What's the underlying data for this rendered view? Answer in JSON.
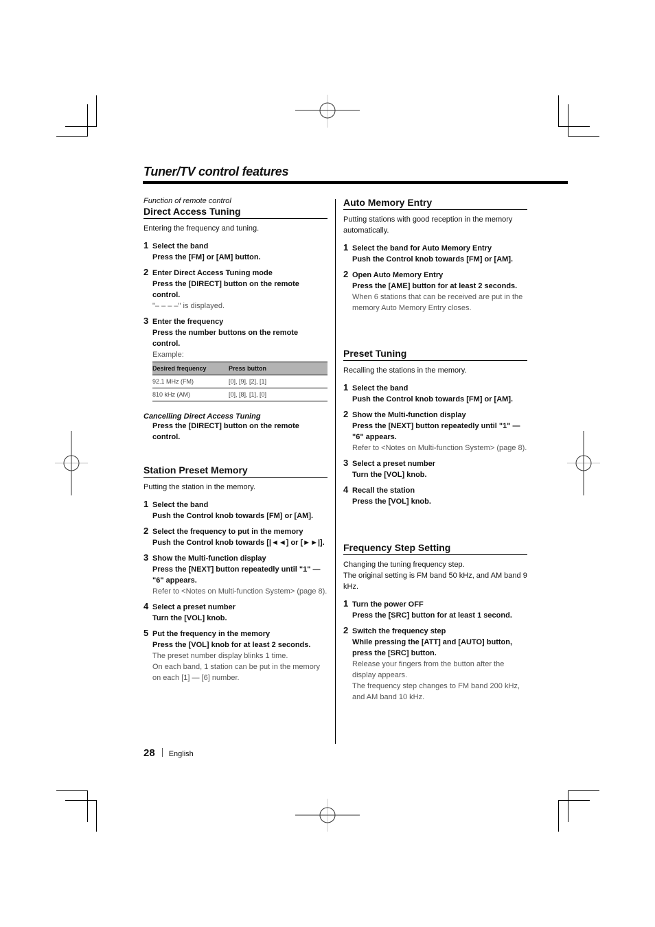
{
  "page": {
    "title": "Tuner/TV control features",
    "page_number": "28",
    "language": "English"
  },
  "left_column": {
    "direct_access": {
      "pre_heading": "Function of remote control",
      "heading": "Direct Access Tuning",
      "intro": "Entering the frequency and tuning.",
      "steps": [
        {
          "num": "1",
          "title": "Select the band",
          "action": "Press the [FM] or [AM] button.",
          "note": ""
        },
        {
          "num": "2",
          "title": "Enter Direct Access Tuning mode",
          "action": "Press the [DIRECT] button on the remote control.",
          "note": "\"– – – –\" is displayed."
        },
        {
          "num": "3",
          "title": "Enter the frequency",
          "action": "Press the number buttons on the remote control.",
          "note": "Example:"
        }
      ],
      "table": {
        "headers": [
          "Desired frequency",
          "Press button"
        ],
        "rows": [
          [
            "92.1 MHz (FM)",
            "[0], [9], [2], [1]"
          ],
          [
            "810 kHz (AM)",
            "[0], [8], [1], [0]"
          ]
        ]
      },
      "cancel": {
        "heading": "Cancelling Direct Access Tuning",
        "action": "Press the [DIRECT] button on the remote control."
      }
    },
    "station_preset": {
      "heading": "Station Preset Memory",
      "intro": "Putting the station in the memory.",
      "steps": [
        {
          "num": "1",
          "title": "Select the band",
          "action": "Push the Control knob towards [FM] or [AM].",
          "note": ""
        },
        {
          "num": "2",
          "title": "Select the frequency to put in the memory",
          "action": "Push the Control knob towards [|◄◄] or [►►|].",
          "note": ""
        },
        {
          "num": "3",
          "title": "Show the Multi-function display",
          "action": "Press the [NEXT] button repeatedly until \"1\" — \"6\" appears.",
          "note": "Refer to <Notes on Multi-function System> (page 8)."
        },
        {
          "num": "4",
          "title": "Select a preset number",
          "action": "Turn the [VOL] knob.",
          "note": ""
        },
        {
          "num": "5",
          "title": "Put the frequency in the memory",
          "action": "Press the [VOL] knob for at least 2 seconds.",
          "note": "The preset number display blinks 1 time.\nOn each band, 1 station can be put in the memory on each [1] — [6] number."
        }
      ]
    }
  },
  "right_column": {
    "auto_memory": {
      "heading": "Auto Memory Entry",
      "intro": "Putting stations with good reception in the memory automatically.",
      "steps": [
        {
          "num": "1",
          "title": "Select the band for Auto Memory Entry",
          "action": "Push the Control knob towards [FM] or [AM].",
          "note": ""
        },
        {
          "num": "2",
          "title": "Open Auto Memory Entry",
          "action": "Press the [AME] button for at least 2 seconds.",
          "note": "When 6 stations that can be received are put in the memory Auto Memory Entry closes."
        }
      ]
    },
    "preset_tuning": {
      "heading": "Preset Tuning",
      "intro": "Recalling the stations in the memory.",
      "steps": [
        {
          "num": "1",
          "title": "Select the band",
          "action": "Push the Control knob towards [FM] or [AM].",
          "note": ""
        },
        {
          "num": "2",
          "title": "Show the Multi-function display",
          "action": "Press the [NEXT] button repeatedly until \"1\" — \"6\" appears.",
          "note": "Refer to <Notes on Multi-function System> (page 8)."
        },
        {
          "num": "3",
          "title": "Select a preset number",
          "action": "Turn the [VOL] knob.",
          "note": ""
        },
        {
          "num": "4",
          "title": "Recall the station",
          "action": "Press the [VOL] knob.",
          "note": ""
        }
      ]
    },
    "freq_step": {
      "heading": "Frequency Step Setting",
      "intro": "Changing the tuning frequency step.\nThe original setting is FM band 50 kHz, and AM band 9 kHz.",
      "steps": [
        {
          "num": "1",
          "title": "Turn the power OFF",
          "action": "Press the [SRC] button for at least 1 second.",
          "note": ""
        },
        {
          "num": "2",
          "title": "Switch the frequency step",
          "action": "While pressing the [ATT] and [AUTO] button, press the [SRC] button.",
          "note": "Release your fingers from the button after the display appears.\nThe frequency step changes to FM band 200 kHz, and AM band 10 kHz."
        }
      ]
    }
  }
}
